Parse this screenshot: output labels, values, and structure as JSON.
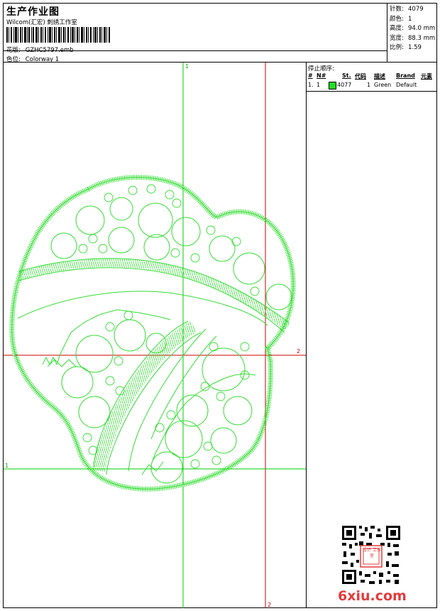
{
  "header": {
    "title": "生产作业图",
    "subtitle": "Wilcom(汇宏) 刺绣工作室",
    "design_label": "花版:",
    "design_value": "GZHC5797.emb",
    "colorway_label": "色位:",
    "colorway_value": "Colorway 1"
  },
  "stats": [
    {
      "label": "针数:",
      "value": "4079"
    },
    {
      "label": "颜色:",
      "value": "1"
    },
    {
      "label": "高度:",
      "value": "94.0 mm"
    },
    {
      "label": "宽度:",
      "value": "88.3 mm"
    },
    {
      "label": "比例:",
      "value": "1.59"
    }
  ],
  "stop_sequence": {
    "title": "停止顺序:",
    "columns": [
      "#",
      "N#",
      "St.",
      "代码",
      "描述",
      "Brand",
      "元素"
    ],
    "rows": [
      {
        "index": "1.",
        "n": "1",
        "stitches": "4077",
        "code": "1",
        "description": "Green",
        "brand": "Default",
        "color": "#22dd22"
      }
    ]
  },
  "guides": {
    "vertical_green_label": "1",
    "vertical_red_label": "2",
    "horizontal_red_label": "2",
    "horizontal_green_label": "1"
  },
  "colors": {
    "stitch": "#33dd33",
    "guide_green": "#00cc00",
    "guide_red": "#cc0000",
    "watermark": "#e23b3b"
  },
  "watermark": "6xiu.com",
  "qr_stamp_text": "设计 工作室"
}
